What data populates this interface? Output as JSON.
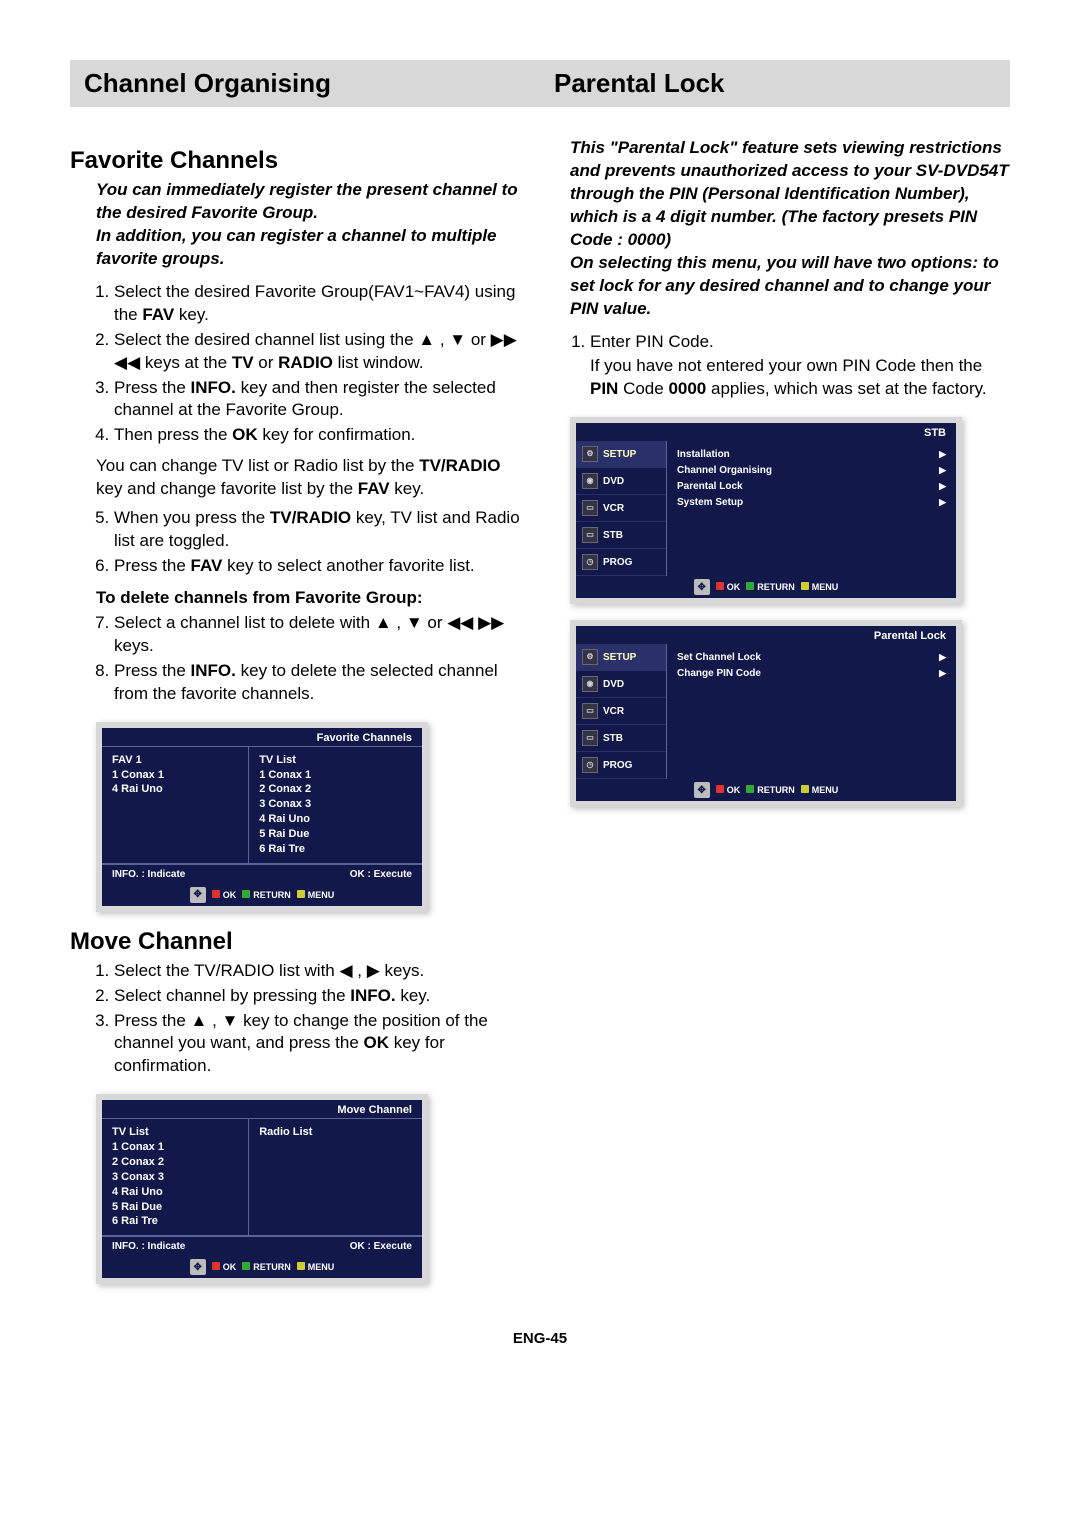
{
  "headers": {
    "left": "Channel Organising",
    "right": "Parental Lock"
  },
  "left": {
    "fav_heading": "Favorite Channels",
    "fav_intro_1": "You can immediately register the present channel to the desired Favorite Group.",
    "fav_intro_2": "In addition, you can register a channel to multiple favorite groups.",
    "step1_a": "Select the desired Favorite Group(FAV1~FAV4) using the ",
    "step1_fav": "FAV",
    "step1_b": " key.",
    "step2_a": "Select the desired channel list using the ▲ , ▼ or ▶▶ ◀◀ keys at the ",
    "step2_tv": "TV",
    "step2_or": " or ",
    "step2_radio": "RADIO",
    "step2_b": " list window.",
    "step3_a": "Press the ",
    "step3_info": "INFO.",
    "step3_b": " key and then register the selected channel at the Favorite Group.",
    "step4_a": "Then press the ",
    "step4_ok": "OK",
    "step4_b": " key for confirmation.",
    "change_a": "You can change TV list or Radio list by the ",
    "change_tvradio": "TV/RADIO",
    "change_b": " key and change favorite list by the ",
    "change_fav": "FAV",
    "change_c": " key.",
    "step5_a": "When you press the ",
    "step5_tvradio": "TV/RADIO",
    "step5_b": " key, TV list and Radio list are toggled.",
    "step6_a": "Press the ",
    "step6_fav": "FAV",
    "step6_b": " key to select another favorite list.",
    "delete_heading": "To delete channels from Favorite Group:",
    "step7": "Select a channel list to delete with ▲ , ▼ or ◀◀ ▶▶ keys.",
    "step8_a": "Press the ",
    "step8_info": "INFO.",
    "step8_b": " key to delete the selected channel from the favorite channels.",
    "move_heading": "Move Channel",
    "m1": "Select the TV/RADIO list with ◀ , ▶ keys.",
    "m2_a": "Select channel by pressing the ",
    "m2_info": "INFO.",
    "m2_b": " key.",
    "m3_a": "Press the ▲ , ▼ key to change the position of the channel you want, and press the ",
    "m3_ok": "OK",
    "m3_b": " key for confirmation."
  },
  "right": {
    "intro_1": "This \"Parental Lock\" feature sets viewing restrictions and prevents unauthorized access to your SV-DVD54T through the PIN (Personal Identification Number), which is a 4 digit number. (The factory presets PIN Code : 0000)",
    "intro_2": "On selecting this menu, you will have two options: to set lock for any desired channel and to change your PIN value.",
    "step1": "Enter PIN Code.",
    "step1_sub_a": "If you have not entered your own PIN Code then the ",
    "step1_pin": "PIN",
    "step1_sub_b": " Code ",
    "step1_0000": "0000",
    "step1_sub_c": " applies, which was set at the factory."
  },
  "osd_fav": {
    "title": "Favorite Channels",
    "left_h": "FAV 1",
    "left_items": [
      "1 Conax 1",
      "4 Rai Uno"
    ],
    "right_h": "TV List",
    "right_items": [
      "1 Conax 1",
      "2 Conax 2",
      "3 Conax 3",
      "4 Rai Uno",
      "5 Rai Due",
      "6 Rai Tre"
    ],
    "hint_l": "INFO. : Indicate",
    "hint_r": "OK : Execute",
    "f_ok": "OK",
    "f_return": "RETURN",
    "f_menu": "MENU"
  },
  "osd_move": {
    "title": "Move Channel",
    "left_h": "TV List",
    "left_items": [
      "1 Conax 1",
      "2 Conax 2",
      "3 Conax 3",
      "4 Rai Uno",
      "5 Rai Due",
      "6 Rai Tre"
    ],
    "right_h": "Radio List",
    "hint_l": "INFO. : Indicate",
    "hint_r": "OK : Execute",
    "f_ok": "OK",
    "f_return": "RETURN",
    "f_menu": "MENU"
  },
  "osd_stb": {
    "title": "STB",
    "tabs": [
      "SETUP",
      "DVD",
      "VCR",
      "STB",
      "PROG"
    ],
    "menu": [
      "Installation",
      "Channel Organising",
      "Parental Lock",
      "System Setup"
    ],
    "f_ok": "OK",
    "f_return": "RETURN",
    "f_menu": "MENU"
  },
  "osd_plock": {
    "title": "Parental Lock",
    "tabs": [
      "SETUP",
      "DVD",
      "VCR",
      "STB",
      "PROG"
    ],
    "menu": [
      "Set Channel Lock",
      "Change  PIN Code"
    ],
    "f_ok": "OK",
    "f_return": "RETURN",
    "f_menu": "MENU"
  },
  "page_num": "ENG-45"
}
